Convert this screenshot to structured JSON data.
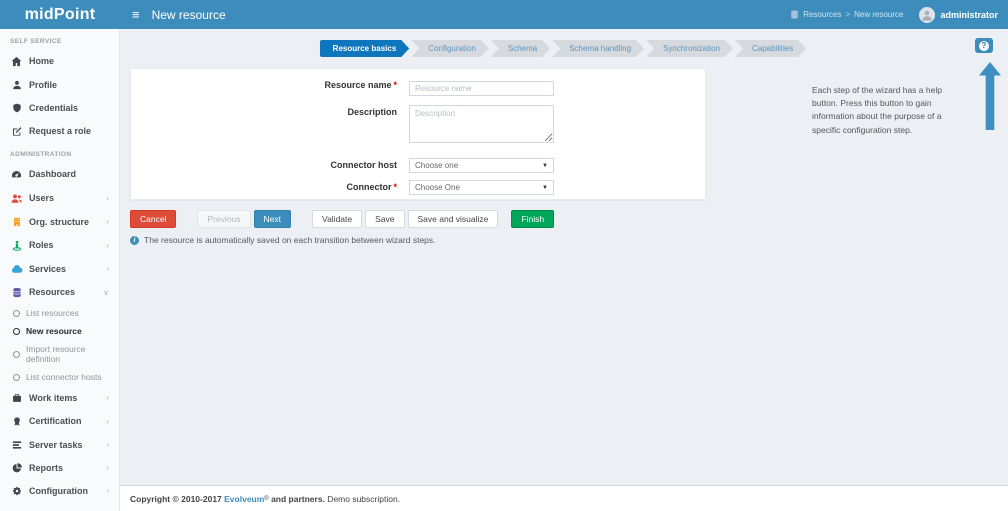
{
  "colors": {
    "header_blue": "#3c8dbc",
    "active_step_blue": "#0d76bd",
    "danger_red": "#dd4b39",
    "success_green": "#00a65a",
    "indigo_resources": "#605ca8",
    "content_bg": "#ecf0f4"
  },
  "icons": {
    "hamburger": "≡",
    "breadcrumb_separator": ">",
    "chevron_collapsed": "‹",
    "chevron_expanded": "∨",
    "dropdown_caret": "▼",
    "info": "i",
    "help": "?"
  },
  "header": {
    "logo": "midPoint",
    "title": "New resource",
    "breadcrumb": {
      "section": "Resources",
      "current": "New resource"
    },
    "username": "administrator"
  },
  "sidebar": {
    "self_service": {
      "label": "SELF SERVICE",
      "items": [
        {
          "label": "Home",
          "icon": "home-icon"
        },
        {
          "label": "Profile",
          "icon": "user-icon"
        },
        {
          "label": "Credentials",
          "icon": "shield-icon"
        },
        {
          "label": "Request a role",
          "icon": "edit-icon"
        }
      ]
    },
    "administration": {
      "label": "ADMINISTRATION",
      "items": [
        {
          "label": "Dashboard",
          "icon": "dashboard-icon"
        },
        {
          "label": "Users",
          "icon": "users-icon"
        },
        {
          "label": "Org. structure",
          "icon": "building-icon"
        },
        {
          "label": "Roles",
          "icon": "street-view-icon"
        },
        {
          "label": "Services",
          "icon": "cloud-icon"
        },
        {
          "label": "Resources",
          "icon": "database-icon",
          "expanded": true
        },
        {
          "label": "Work items",
          "icon": "briefcase-icon"
        },
        {
          "label": "Certification",
          "icon": "certificate-icon"
        },
        {
          "label": "Server tasks",
          "icon": "tasks-icon"
        },
        {
          "label": "Reports",
          "icon": "pie-chart-icon"
        },
        {
          "label": "Configuration",
          "icon": "gear-icon"
        }
      ]
    },
    "resources_submenu": [
      {
        "label": "List resources",
        "active": false
      },
      {
        "label": "New resource",
        "active": true
      },
      {
        "label": "Import resource definition",
        "active": false
      },
      {
        "label": "List connector hosts",
        "active": false
      }
    ]
  },
  "wizard": {
    "steps": [
      {
        "label": "Resource basics",
        "active": true
      },
      {
        "label": "Configuration",
        "active": false
      },
      {
        "label": "Schema",
        "active": false
      },
      {
        "label": "Schema handling",
        "active": false
      },
      {
        "label": "Synchronization",
        "active": false
      },
      {
        "label": "Capabilities",
        "active": false
      }
    ]
  },
  "form": {
    "resource_name": {
      "label": "Resource name",
      "required_mark": "*",
      "placeholder": "Resource name"
    },
    "description": {
      "label": "Description",
      "placeholder": "Description"
    },
    "connector_host": {
      "label": "Connector host",
      "value": "Choose one"
    },
    "connector": {
      "label": "Connector",
      "required_mark": "*",
      "value": "Choose One"
    }
  },
  "buttons": {
    "cancel": "Cancel",
    "previous": "Previous",
    "next": "Next",
    "validate": "Validate",
    "save": "Save",
    "save_and_visualize": "Save and visualize",
    "finish": "Finish"
  },
  "note": {
    "text": "The resource is automatically saved on each transition between wizard steps."
  },
  "help": {
    "text": "Each step of the wizard has a help button. Press this button to gain information about the purpose of a specific configuration step."
  },
  "footer": {
    "copyright_prefix": "Copyright © 2010-2017 ",
    "brand": "Evolveum",
    "registered": "®",
    "partners_suffix": " and partners.",
    "demo": " Demo subscription."
  }
}
